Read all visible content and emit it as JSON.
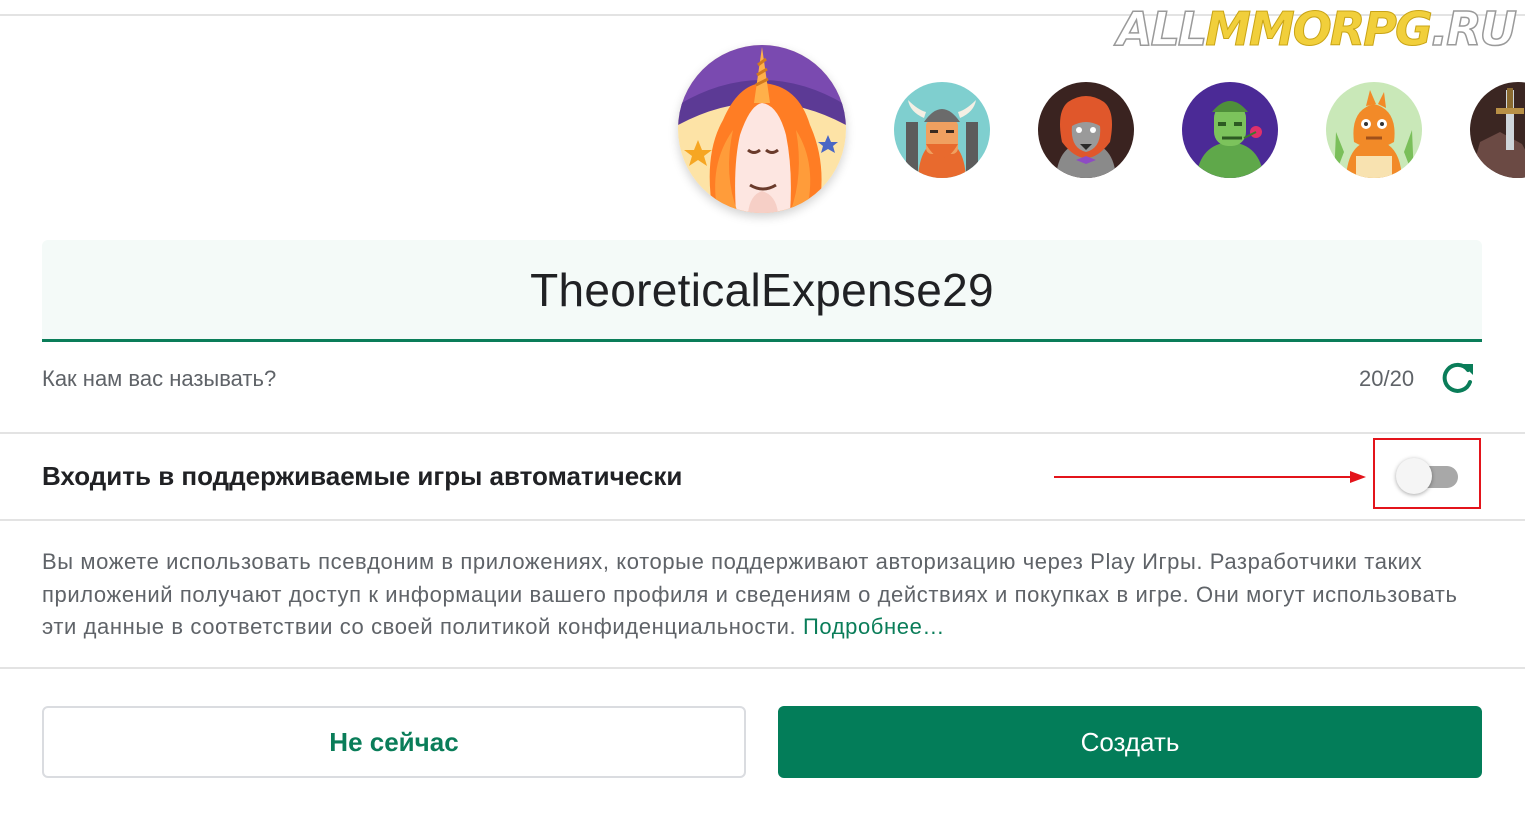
{
  "watermark": {
    "part1": "ALL",
    "part2": "MMORPG",
    "part3": ".RU"
  },
  "avatars": [
    {
      "name": "unicorn",
      "selected": true
    },
    {
      "name": "viking"
    },
    {
      "name": "werewolf"
    },
    {
      "name": "green-soldier"
    },
    {
      "name": "orange-dragon"
    },
    {
      "name": "sword-in-stone"
    }
  ],
  "name_field": {
    "value": "TheoreticalExpense29"
  },
  "hint": "Как нам вас называть?",
  "counter": "20/20",
  "refresh_icon": "refresh-icon",
  "auto_signin": {
    "label": "Входить в поддерживаемые игры автоматически",
    "enabled": false
  },
  "annotation": {
    "arrow_color": "#e3141b",
    "box_color": "#e3141b"
  },
  "description": {
    "text": "Вы можете использовать псевдоним в приложениях, которые поддерживают авторизацию через Play Игры. Разработчики таких приложений получают доступ к информации вашего профиля и сведениям о действиях и покупках в игре. Они могут использовать эти данные в соответствии со своей политикой конфиденциальности.",
    "link": "Подробнее…"
  },
  "buttons": {
    "cancel": "Не сейчас",
    "create": "Создать"
  },
  "colors": {
    "accent": "#0a7d59",
    "primary_button": "#037d59"
  }
}
